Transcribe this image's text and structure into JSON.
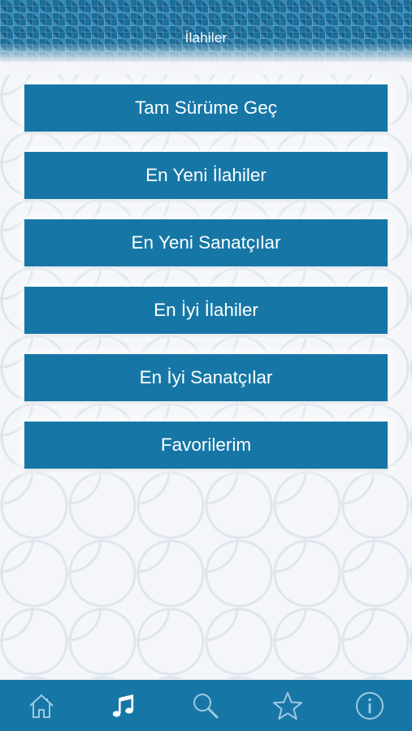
{
  "header": {
    "title": "İlahiler"
  },
  "menu": [
    {
      "label": "Tam Sürüme Geç"
    },
    {
      "label": "En Yeni İlahiler"
    },
    {
      "label": "En Yeni Sanatçılar"
    },
    {
      "label": "En İyi İlahiler"
    },
    {
      "label": "En İyi Sanatçılar"
    },
    {
      "label": "Favorilerim"
    }
  ],
  "tabbar": {
    "items": [
      {
        "icon": "home-icon",
        "active": false
      },
      {
        "icon": "music-note-icon",
        "active": true
      },
      {
        "icon": "search-icon",
        "active": false
      },
      {
        "icon": "star-icon",
        "active": false
      },
      {
        "icon": "info-icon",
        "active": false
      }
    ]
  },
  "colors": {
    "primary": "#1677a6",
    "header": "#1a6f9c",
    "icon_inactive": "#9fc9e0",
    "icon_active": "#ffffff",
    "background": "#f4f6f9"
  }
}
